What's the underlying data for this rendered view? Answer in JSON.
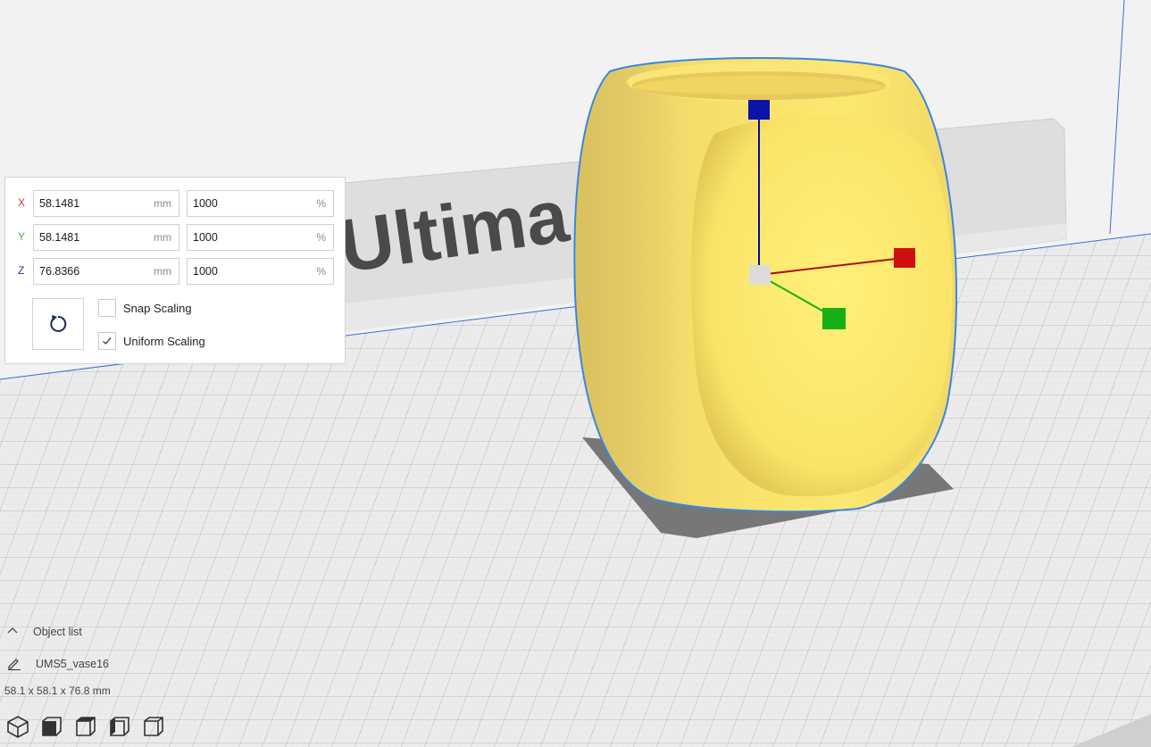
{
  "scene": {
    "backplate_text": "Ultima",
    "object_color": "#f7df6b",
    "axis_colors": {
      "x": "#d01010",
      "y": "#16b016",
      "z": "#0a0aa0"
    }
  },
  "scale_tool": {
    "rows": [
      {
        "axis": "X",
        "axis_color": "#d0342c",
        "mm_value": "58.1481",
        "mm_unit": "mm",
        "percent_value": "1000",
        "percent_unit": "%"
      },
      {
        "axis": "Y",
        "axis_color": "#4caf50",
        "mm_value": "58.1481",
        "mm_unit": "mm",
        "percent_value": "1000",
        "percent_unit": "%"
      },
      {
        "axis": "Z",
        "axis_color": "#283593",
        "mm_value": "76.8366",
        "mm_unit": "mm",
        "percent_value": "1000",
        "percent_unit": "%"
      }
    ],
    "reset_icon": "reset-icon",
    "snap_scaling": {
      "label": "Snap Scaling",
      "checked": false
    },
    "uniform_scaling": {
      "label": "Uniform Scaling",
      "checked": true
    }
  },
  "object_list": {
    "header": "Object list",
    "object_name": "UMS5_vase16",
    "dimensions": "58.1 x 58.1 x 76.8 mm"
  },
  "view_buttons": [
    "3d-view-icon",
    "front-view-icon",
    "top-view-icon",
    "left-view-icon",
    "right-view-icon"
  ]
}
